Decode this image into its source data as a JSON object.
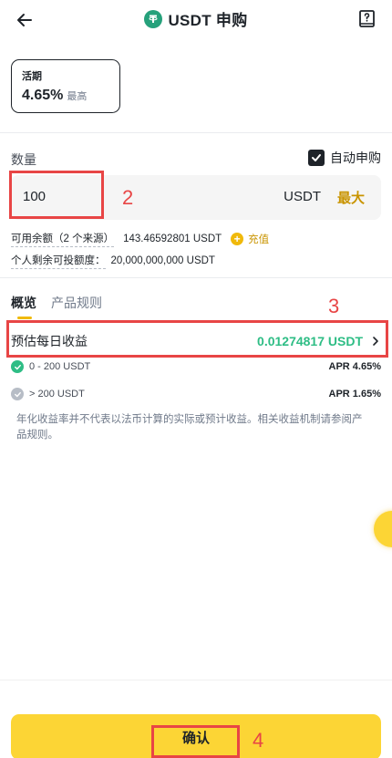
{
  "header": {
    "title": "USDT 申购"
  },
  "term_card": {
    "label": "活期",
    "rate": "4.65%",
    "rate_suffix": "最高"
  },
  "quantity": {
    "label": "数量",
    "auto_subscribe_label": "自动申购",
    "auto_subscribe_checked": true,
    "amount_value": "100",
    "unit": "USDT",
    "max_label": "最大"
  },
  "balance": {
    "available_label": "可用余额（2 个来源）",
    "available_value": "143.46592801 USDT",
    "recharge_label": "充值",
    "quota_label": "个人剩余可投额度：",
    "quota_value": "20,000,000,000 USDT"
  },
  "tabs": [
    {
      "label": "概览",
      "active": true
    },
    {
      "label": "产品规则",
      "active": false
    }
  ],
  "estimate": {
    "label": "预估每日收益",
    "value": "0.01274817 USDT"
  },
  "tiers": [
    {
      "range": "0 - 200 USDT",
      "apr": "APR 4.65%",
      "active": true
    },
    {
      "range": "> 200 USDT",
      "apr": "APR 1.65%",
      "active": false
    }
  ],
  "disclaimer": "年化收益率并不代表以法币计算的实际或预计收益。相关收益机制请参阅产品规则。",
  "confirm_label": "确认",
  "annotations": [
    "2",
    "3",
    "4"
  ],
  "colors": {
    "accent_yellow": "#fcd535",
    "max_text": "#c99400",
    "green": "#2ebd85",
    "annotation_red": "#e84545"
  }
}
